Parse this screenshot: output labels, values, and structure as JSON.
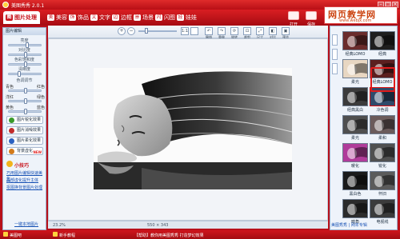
{
  "app": {
    "title": "美图秀秀 2.0.1",
    "window_buttons": [
      "–",
      "□",
      "×"
    ]
  },
  "tabs": [
    {
      "label": "图片处理",
      "icon": "图",
      "active": true
    },
    {
      "label": "美容",
      "icon": "美",
      "active": false
    },
    {
      "label": "饰品",
      "icon": "饰",
      "active": false
    },
    {
      "label": "文字",
      "icon": "文",
      "active": false
    },
    {
      "label": "边框",
      "icon": "边",
      "active": false
    },
    {
      "label": "场景",
      "icon": "景",
      "active": false
    },
    {
      "label": "闪图",
      "icon": "闪",
      "active": false
    },
    {
      "label": "娃娃",
      "icon": "娃",
      "active": false
    }
  ],
  "top_actions": [
    "打开",
    "保存"
  ],
  "watermark": {
    "line1": "网页教学网",
    "line2": "www.webjx.com"
  },
  "left_panel": {
    "header": "图片编辑",
    "sliders": [
      {
        "label": "亮度",
        "value": 0.55
      },
      {
        "label": "对比度",
        "value": 0.5
      },
      {
        "label": "色彩饱和度",
        "value": 0.5
      },
      {
        "label": "清晰度",
        "value": 0.3
      },
      {
        "label": "色调调节",
        "value": 0.5
      }
    ],
    "color_sliders": [
      {
        "left": "青色",
        "right": "红色",
        "value": 0.5
      },
      {
        "left": "洋红",
        "right": "绿色",
        "value": 0.5
      },
      {
        "left": "黄色",
        "right": "蓝色",
        "value": 0.5
      }
    ],
    "effect_buttons": [
      {
        "label": "图片锐化效果",
        "color": "#3a9a2a"
      },
      {
        "label": "图片消噪效果",
        "color": "#c12b2b"
      },
      {
        "label": "图片柔化效果",
        "color": "#2b61c1"
      },
      {
        "label": "背景虚化",
        "color": "#d27a1b",
        "badge": "NEW"
      }
    ],
    "tips_title": "小技巧",
    "tips": [
      "巧用图片编辑快速美化",
      "局部虚化提升主体",
      "抠图换背景图片处理"
    ],
    "footer_link": "一键本地图片"
  },
  "toolbar": {
    "zoom_in": "+",
    "zoom_out": "−",
    "fit": "1:1",
    "actions": [
      "撤销",
      "重做",
      "旋转",
      "裁剪",
      "尺寸",
      "对比",
      "预览"
    ]
  },
  "status": {
    "left": "23.2%",
    "right": "550 × 343"
  },
  "right_panel": {
    "effects": [
      {
        "label": "经典LOMO",
        "bg": "#6a2c2c"
      },
      {
        "label": "经典",
        "bg": "#1e1e1e"
      },
      {
        "label": "柔光",
        "bg": "#e8d7c2"
      },
      {
        "label": "经典LOMO",
        "bg": "#5b1f1f"
      },
      {
        "label": "经典黑白",
        "bg": "#3b3b3b"
      },
      {
        "label": "冷色调",
        "bg": "#2f4a6a"
      },
      {
        "label": "柔光",
        "bg": "#4f4f4f"
      },
      {
        "label": "柔和",
        "bg": "#6b5b5b"
      },
      {
        "label": "暖化",
        "bg": "#b03c9a"
      },
      {
        "label": "锐化",
        "bg": "#505050"
      },
      {
        "label": "黑白色",
        "bg": "#1a1a1a"
      },
      {
        "label": "怀旧",
        "bg": "#5b5b5b"
      },
      {
        "label": "暗角",
        "bg": "#2b2b2b"
      },
      {
        "label": "电视线",
        "bg": "#3b3b3b"
      }
    ],
    "selected_index": 5,
    "footer": "美图秀秀 | 网年专辑"
  },
  "bottom_bar": [
    "美图吧",
    "新手教程",
    "【帮助】教你用美图秀秀 打造梦幻效果"
  ]
}
